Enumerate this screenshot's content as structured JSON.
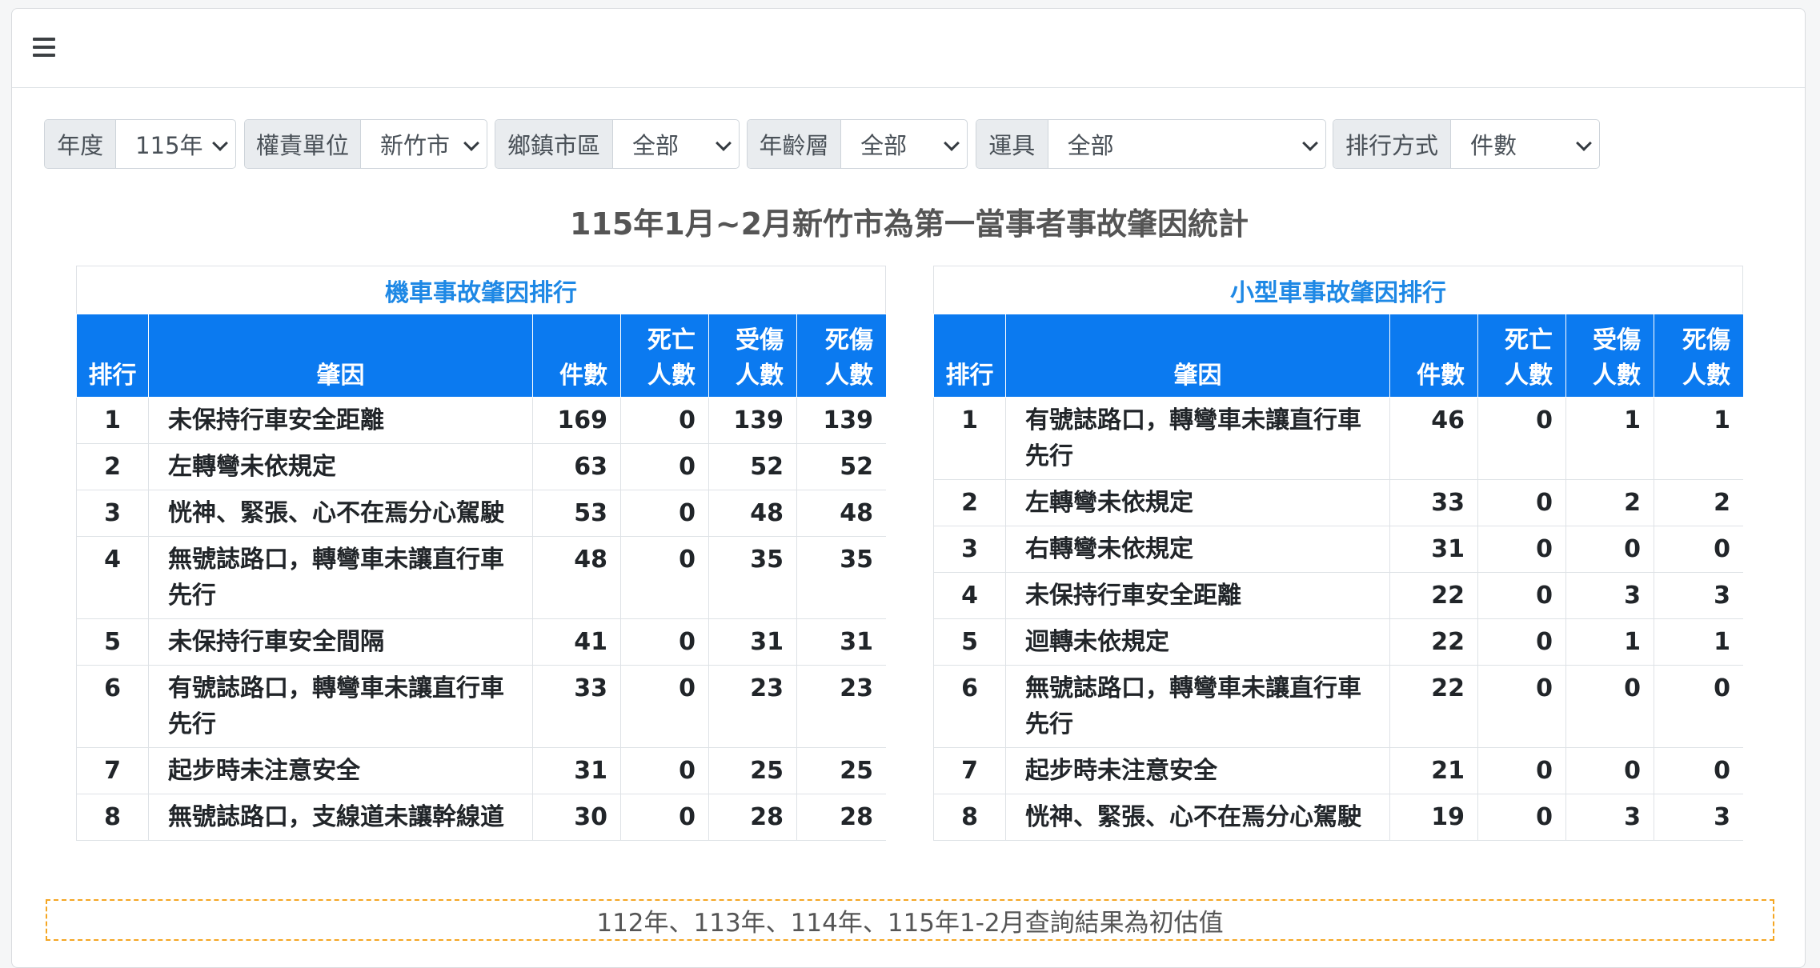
{
  "filters": [
    {
      "label": "年度",
      "value": "115年"
    },
    {
      "label": "權責單位",
      "value": "新竹市"
    },
    {
      "label": "鄉鎮市區",
      "value": "全部"
    },
    {
      "label": "年齡層",
      "value": "全部"
    },
    {
      "label": "運具",
      "value": "全部"
    },
    {
      "label": "排行方式",
      "value": "件數"
    }
  ],
  "heading": "115年1月~2月新竹市為第一當事者事故肇因統計",
  "columns": {
    "rank": "排行",
    "cause": "肇因",
    "count": "件數",
    "deaths": "死亡人數",
    "injuries": "受傷人數",
    "casualties": "死傷人數"
  },
  "motorcycle": {
    "title": "機車事故肇因排行",
    "rows": [
      {
        "rank": "1",
        "cause": "未保持行車安全距離",
        "count": "169",
        "deaths": "0",
        "injuries": "139",
        "casualties": "139"
      },
      {
        "rank": "2",
        "cause": "左轉彎未依規定",
        "count": "63",
        "deaths": "0",
        "injuries": "52",
        "casualties": "52"
      },
      {
        "rank": "3",
        "cause": "恍神、緊張、心不在焉分心駕駛",
        "count": "53",
        "deaths": "0",
        "injuries": "48",
        "casualties": "48"
      },
      {
        "rank": "4",
        "cause": "無號誌路口，轉彎車未讓直行車先行",
        "count": "48",
        "deaths": "0",
        "injuries": "35",
        "casualties": "35"
      },
      {
        "rank": "5",
        "cause": "未保持行車安全間隔",
        "count": "41",
        "deaths": "0",
        "injuries": "31",
        "casualties": "31"
      },
      {
        "rank": "6",
        "cause": "有號誌路口，轉彎車未讓直行車先行",
        "count": "33",
        "deaths": "0",
        "injuries": "23",
        "casualties": "23"
      },
      {
        "rank": "7",
        "cause": "起步時未注意安全",
        "count": "31",
        "deaths": "0",
        "injuries": "25",
        "casualties": "25"
      },
      {
        "rank": "8",
        "cause": "無號誌路口，支線道未讓幹線道",
        "count": "30",
        "deaths": "0",
        "injuries": "28",
        "casualties": "28"
      }
    ]
  },
  "car": {
    "title": "小型車事故肇因排行",
    "rows": [
      {
        "rank": "1",
        "cause": "有號誌路口，轉彎車未讓直行車先行",
        "count": "46",
        "deaths": "0",
        "injuries": "1",
        "casualties": "1"
      },
      {
        "rank": "2",
        "cause": "左轉彎未依規定",
        "count": "33",
        "deaths": "0",
        "injuries": "2",
        "casualties": "2"
      },
      {
        "rank": "3",
        "cause": "右轉彎未依規定",
        "count": "31",
        "deaths": "0",
        "injuries": "0",
        "casualties": "0"
      },
      {
        "rank": "4",
        "cause": "未保持行車安全距離",
        "count": "22",
        "deaths": "0",
        "injuries": "3",
        "casualties": "3"
      },
      {
        "rank": "5",
        "cause": "迴轉未依規定",
        "count": "22",
        "deaths": "0",
        "injuries": "1",
        "casualties": "1"
      },
      {
        "rank": "6",
        "cause": "無號誌路口，轉彎車未讓直行車先行",
        "count": "22",
        "deaths": "0",
        "injuries": "0",
        "casualties": "0"
      },
      {
        "rank": "7",
        "cause": "起步時未注意安全",
        "count": "21",
        "deaths": "0",
        "injuries": "0",
        "casualties": "0"
      },
      {
        "rank": "8",
        "cause": "恍神、緊張、心不在焉分心駕駛",
        "count": "19",
        "deaths": "0",
        "injuries": "3",
        "casualties": "3"
      }
    ]
  },
  "note": "112年、113年、114年、115年1-2月查詢結果為初估值",
  "colors": {
    "header_blue": "#0b7af0",
    "title_blue": "#1e88e5",
    "note_border": "#f5a623"
  }
}
